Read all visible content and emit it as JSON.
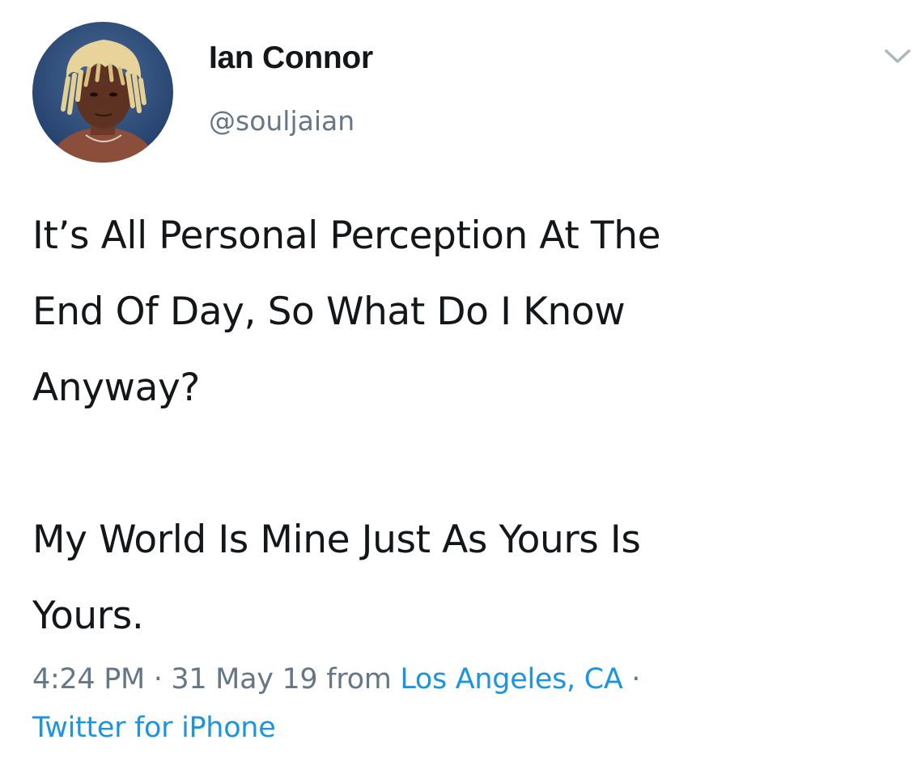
{
  "tweet": {
    "author": {
      "display_name": "Ian Connor",
      "handle": "@souljaian"
    },
    "text": {
      "line1": "It’s All Personal Perception At The",
      "line2": "End Of Day, So What Do I Know",
      "line3": "Anyway?",
      "line4": "My World Is Mine Just As Yours Is",
      "line5": "Yours."
    },
    "meta": {
      "time": "4:24 PM",
      "separator": " · ",
      "date": "31 May 19",
      "from_label": " from ",
      "location": "Los Angeles, CA",
      "trailing_separator": " ·",
      "source": "Twitter for iPhone"
    }
  },
  "icons": {
    "avatar": "profile-photo",
    "menu": "chevron-down-icon"
  },
  "colors": {
    "text": "#14171a",
    "secondary": "#657786",
    "link": "#1b95e0"
  }
}
